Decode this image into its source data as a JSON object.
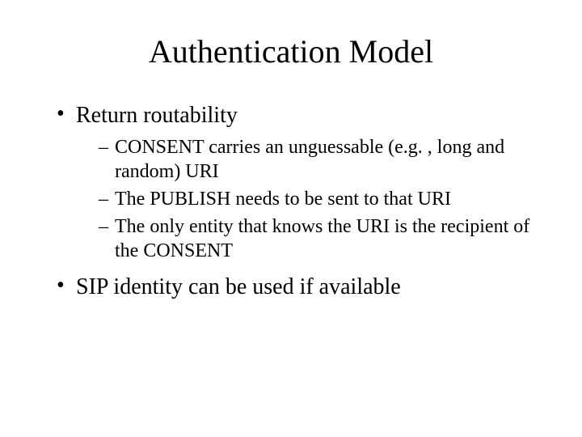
{
  "slide": {
    "title": "Authentication Model",
    "bullets": [
      {
        "text": "Return routability",
        "sub": [
          "CONSENT carries an unguessable (e.g. , long and random) URI",
          "The PUBLISH needs to be sent to that URI",
          "The only entity that knows the URI is the recipient of the CONSENT"
        ]
      },
      {
        "text": "SIP identity can be used if available",
        "sub": []
      }
    ]
  }
}
